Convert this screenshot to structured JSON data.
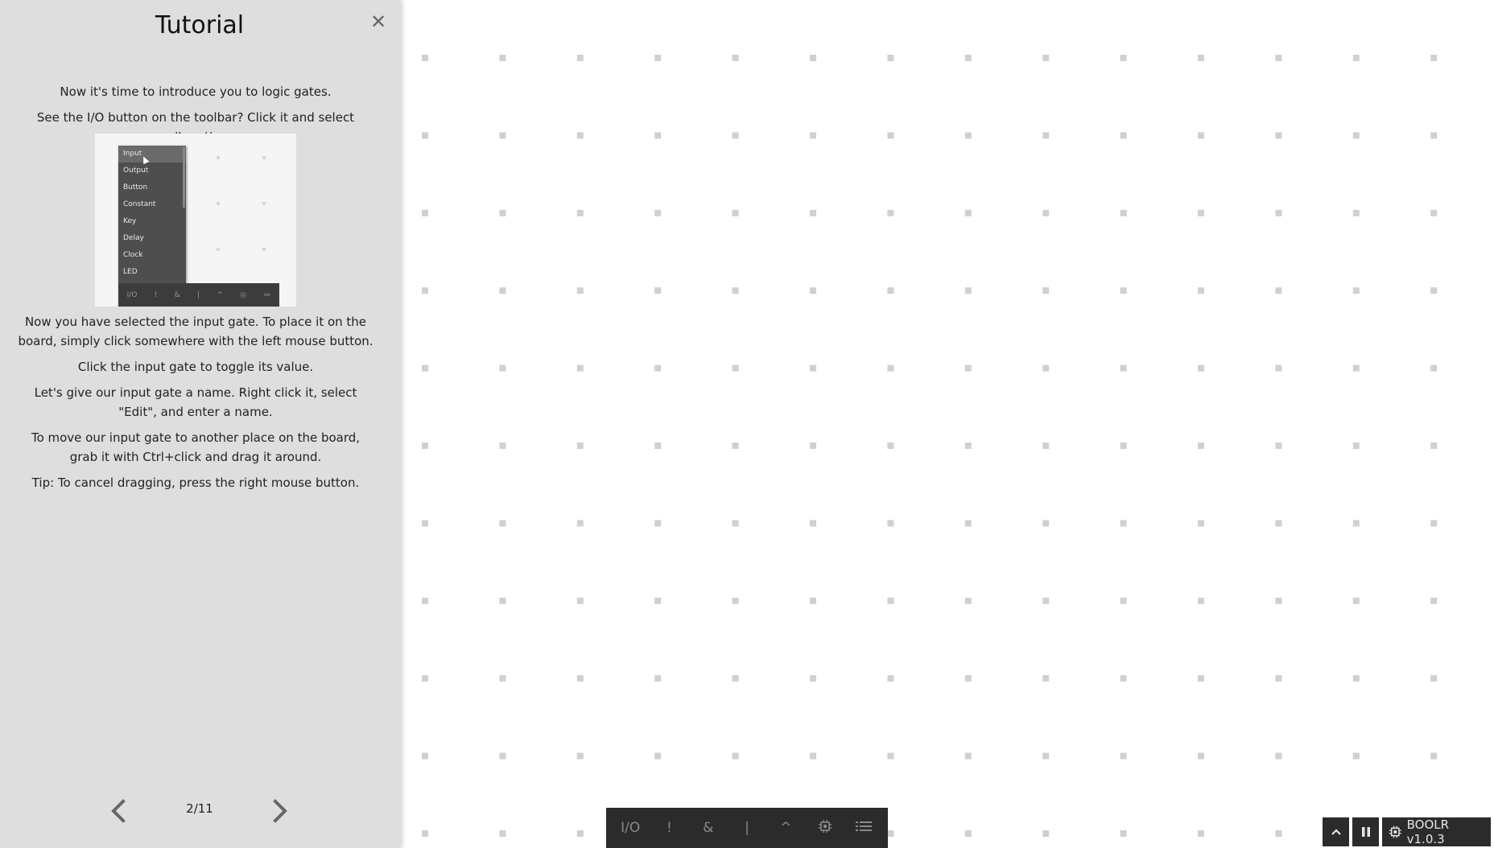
{
  "tutorial": {
    "title": "Tutorial",
    "close_symbol": "✕",
    "paragraphs": [
      "Now it's time to introduce you to logic gates.",
      "See the I/O button on the toolbar? Click it and select 'Input'.",
      "Now you have selected the input gate. To place it on the board, simply click somewhere with the left mouse button.",
      "Click the input gate to toggle its value.",
      "Let's give our input gate a name. Right click it, select \"Edit\", and enter a name.",
      "To move our input gate to another place on the board, grab it with Ctrl+click and drag it around.",
      "Tip: To cancel dragging, press the right mouse button."
    ],
    "preview": {
      "menu_items": [
        "Input",
        "Output",
        "Button",
        "Constant",
        "Key",
        "Delay",
        "Clock",
        "LED"
      ],
      "toolbar": [
        "I/O",
        "!",
        "&",
        "|",
        "^",
        "◎",
        "≔"
      ]
    },
    "pager": {
      "label": "2/11",
      "prev_icon": "chevron-left-icon",
      "next_icon": "chevron-right-icon"
    }
  },
  "toolbar": {
    "buttons": [
      {
        "label": "I/O",
        "name": "io-button"
      },
      {
        "label": "!",
        "name": "not-gate-button"
      },
      {
        "label": "&",
        "name": "and-gate-button"
      },
      {
        "label": "|",
        "name": "or-gate-button"
      },
      {
        "label": "^",
        "name": "xor-gate-button"
      },
      {
        "label": "",
        "name": "component-button",
        "icon": "chip-icon"
      },
      {
        "label": "",
        "name": "list-button",
        "icon": "list-icon"
      }
    ]
  },
  "corner": {
    "expand_icon": "chevron-up-icon",
    "pause_icon": "pause-icon",
    "version_label": "BOOLR v1.0.3",
    "version_icon": "chip-icon"
  },
  "colors": {
    "panel_bg": "#dedede",
    "toolbar_bg": "#2b2b2b",
    "grid_dot": "#d0d0d0"
  }
}
